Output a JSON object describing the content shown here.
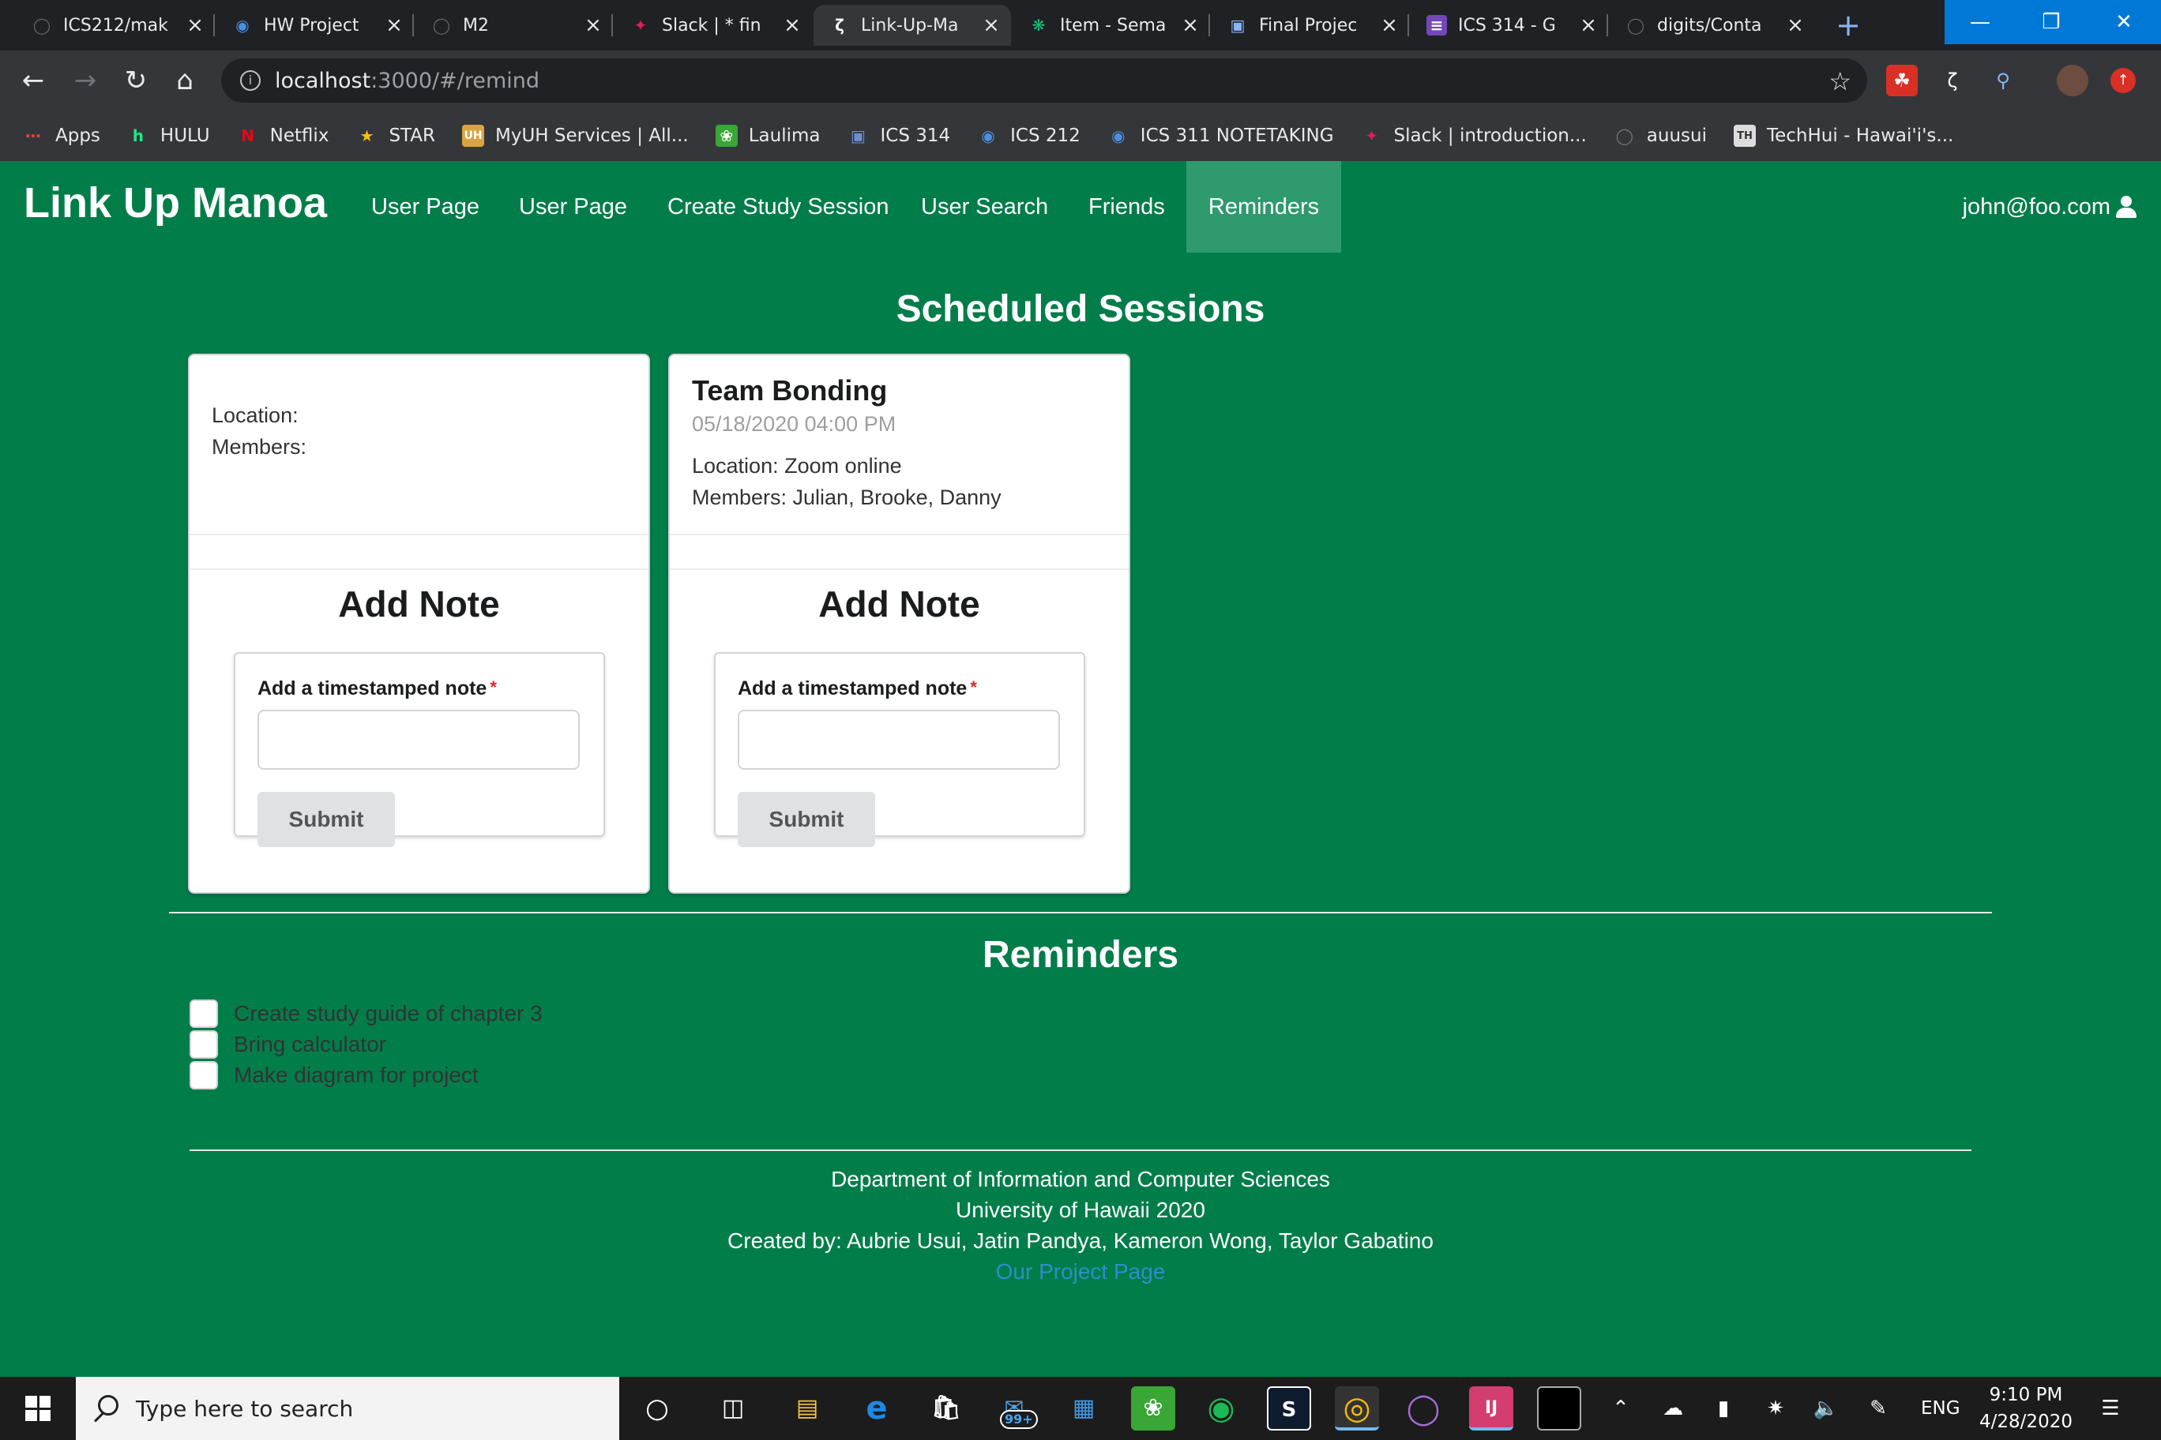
{
  "browser": {
    "tabs": [
      {
        "title": "ICS212/mak",
        "icon": "github-icon",
        "active": false
      },
      {
        "title": "HW Project",
        "icon": "globe-icon",
        "active": false
      },
      {
        "title": "M2",
        "icon": "github-icon",
        "active": false
      },
      {
        "title": "Slack | * fin",
        "icon": "slack-icon",
        "active": false
      },
      {
        "title": "Link-Up-Ma",
        "icon": "link-up-icon",
        "active": true
      },
      {
        "title": "Item - Sema",
        "icon": "openai-icon",
        "active": false
      },
      {
        "title": "Final Projec",
        "icon": "page-icon",
        "active": false
      },
      {
        "title": "ICS 314 - G",
        "icon": "forms-icon",
        "active": false
      },
      {
        "title": "digits/Conta",
        "icon": "github-icon",
        "active": false
      }
    ],
    "url_host": "localhost",
    "url_path": ":3000/#/remind",
    "bookmarks": [
      {
        "label": "Apps",
        "icon": "apps-grid-icon",
        "color": "#e8453c"
      },
      {
        "label": "HULU",
        "icon": "hulu-icon",
        "color": "#1ce783"
      },
      {
        "label": "Netflix",
        "icon": "netflix-icon",
        "color": "#e50914"
      },
      {
        "label": "STAR",
        "icon": "star-icon",
        "color": "#f4c20d"
      },
      {
        "label": "MyUH Services | All...",
        "icon": "uh-icon",
        "color": "#d9a441"
      },
      {
        "label": "Laulima",
        "icon": "laulima-icon",
        "color": "#3aa635"
      },
      {
        "label": "ICS 314",
        "icon": "page-icon",
        "color": "#6b8ed6"
      },
      {
        "label": "ICS 212",
        "icon": "globe-icon",
        "color": "#4a90e2"
      },
      {
        "label": "ICS 311 NOTETAKING",
        "icon": "globe-icon",
        "color": "#4a90e2"
      },
      {
        "label": "Slack | introduction...",
        "icon": "slack-icon",
        "color": "#e01e5a"
      },
      {
        "label": "auusui",
        "icon": "github-icon",
        "color": "#555555"
      },
      {
        "label": "TechHui - Hawai'i's...",
        "icon": "techhui-icon",
        "color": "#dddddd"
      }
    ]
  },
  "app": {
    "brand": "Link Up Manoa",
    "nav": [
      {
        "label": "User Page",
        "active": false
      },
      {
        "label": "User Page",
        "active": false
      },
      {
        "label": "Create Study Session",
        "active": false
      },
      {
        "label": "User Search",
        "active": false
      },
      {
        "label": "Friends",
        "active": false
      },
      {
        "label": "Reminders",
        "active": true
      }
    ],
    "user_email": "john@foo.com"
  },
  "sessions": {
    "heading": "Scheduled Sessions",
    "cards": [
      {
        "title": "",
        "datetime": "",
        "location": "Location:",
        "members": "Members:",
        "note_heading": "Add Note",
        "field_label": "Add a timestamped note",
        "required_mark": "*",
        "input_value": "",
        "submit_label": "Submit"
      },
      {
        "title": "Team Bonding",
        "datetime": "05/18/2020 04:00 PM",
        "location": "Location: Zoom online",
        "members": "Members: Julian, Brooke, Danny",
        "note_heading": "Add Note",
        "field_label": "Add a timestamped note",
        "required_mark": "*",
        "input_value": "",
        "submit_label": "Submit"
      }
    ]
  },
  "reminders": {
    "heading": "Reminders",
    "items": [
      {
        "text": "Create study guide of chapter 3",
        "checked": false
      },
      {
        "text": "Bring calculator",
        "checked": false
      },
      {
        "text": "Make diagram for project",
        "checked": false
      }
    ]
  },
  "footer": {
    "line1": "Department of Information and Computer Sciences",
    "line2": "University of Hawaii 2020",
    "line3": "Created by: Aubrie Usui, Jatin Pandya, Kameron Wong, Taylor Gabatino",
    "link": "Our Project Page"
  },
  "taskbar": {
    "search_placeholder": "Type here to search",
    "mail_badge": "99+",
    "language": "ENG",
    "time": "9:10 PM",
    "date": "4/28/2020"
  }
}
